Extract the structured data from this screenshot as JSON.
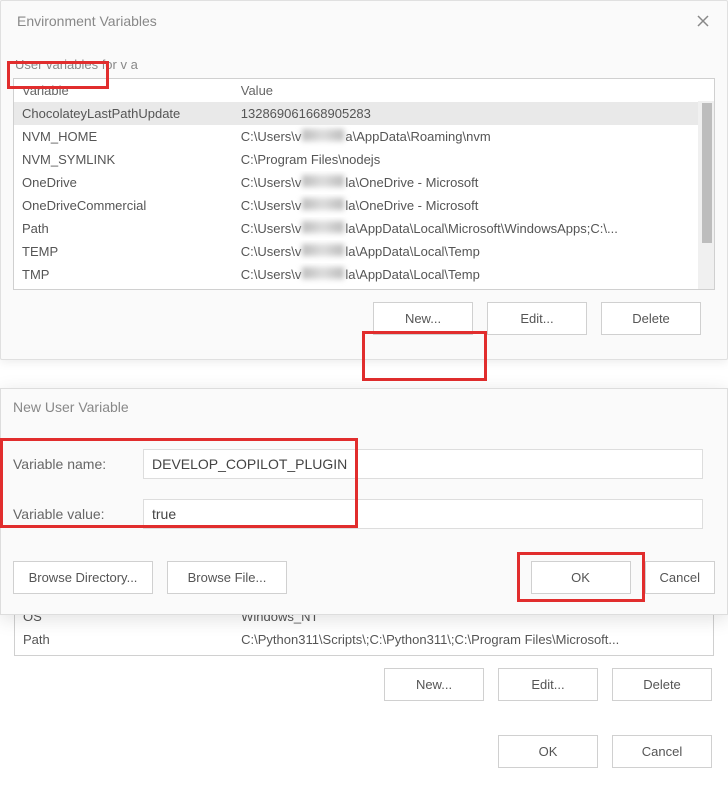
{
  "window": {
    "title": "Environment Variables"
  },
  "user_section": {
    "group_label": "User variables for v           a",
    "header_var": "Variable",
    "header_val": "Value",
    "rows": [
      {
        "variable": "ChocolateyLastPathUpdate",
        "value": "132869061668905283",
        "selected": true
      },
      {
        "variable": "NVM_HOME",
        "value_prefix": "C:\\Users\\v",
        "value_suffix": "a\\AppData\\Roaming\\nvm"
      },
      {
        "variable": "NVM_SYMLINK",
        "value": "C:\\Program Files\\nodejs"
      },
      {
        "variable": "OneDrive",
        "value_prefix": "C:\\Users\\v",
        "value_suffix": "la\\OneDrive - Microsoft"
      },
      {
        "variable": "OneDriveCommercial",
        "value_prefix": "C:\\Users\\v",
        "value_suffix": "la\\OneDrive - Microsoft"
      },
      {
        "variable": "Path",
        "value_prefix": "C:\\Users\\v",
        "value_suffix": "la\\AppData\\Local\\Microsoft\\WindowsApps;C:\\..."
      },
      {
        "variable": "TEMP",
        "value_prefix": "C:\\Users\\v",
        "value_suffix": "la\\AppData\\Local\\Temp"
      },
      {
        "variable": "TMP",
        "value_prefix": "C:\\Users\\v",
        "value_suffix": "la\\AppData\\Local\\Temp"
      }
    ],
    "buttons": {
      "new": "New...",
      "edit": "Edit...",
      "delete": "Delete"
    }
  },
  "new_dialog": {
    "title": "New User Variable",
    "name_label": "Variable name:",
    "name_value": "DEVELOP_COPILOT_PLUGIN",
    "value_label": "Variable value:",
    "value_value": "true",
    "browse_dir": "Browse Directory...",
    "browse_file": "Browse File...",
    "ok": "OK",
    "cancel": "Cancel"
  },
  "system_section": {
    "rows": [
      {
        "variable": "OS",
        "value": "Windows_NT"
      },
      {
        "variable": "Path",
        "value": "C:\\Python311\\Scripts\\;C:\\Python311\\;C:\\Program Files\\Microsoft..."
      }
    ],
    "buttons": {
      "new": "New...",
      "edit": "Edit...",
      "delete": "Delete"
    }
  },
  "footer": {
    "ok": "OK",
    "cancel": "Cancel"
  }
}
